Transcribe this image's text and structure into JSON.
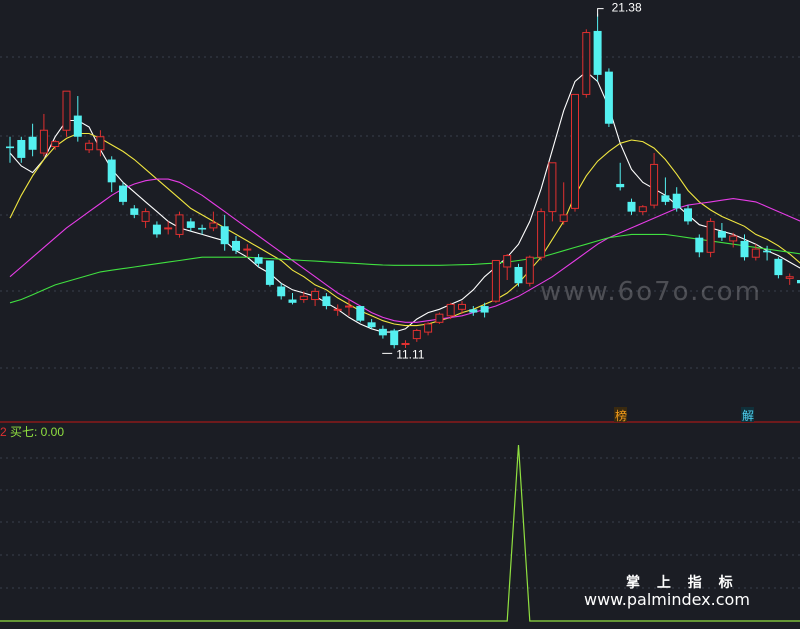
{
  "chart_data": [
    {
      "type": "candlestick",
      "panel": "main",
      "price_range": [
        8.9,
        21.8
      ],
      "high_label": "21.38",
      "low_label": "11.11",
      "candles": [
        {
          "o": 17.3,
          "h": 17.6,
          "l": 16.8,
          "c": 17.25,
          "ma": "up"
        },
        {
          "o": 17.5,
          "h": 17.6,
          "l": 16.8,
          "c": 16.95,
          "ma": "down"
        },
        {
          "o": 17.6,
          "h": 18.0,
          "l": 17.0,
          "c": 17.2,
          "ma": "down"
        },
        {
          "o": 17.1,
          "h": 18.3,
          "l": 17.0,
          "c": 17.8,
          "ma": "up"
        },
        {
          "o": 17.3,
          "h": 17.5,
          "l": 17.2,
          "c": 17.45,
          "ma": "up"
        },
        {
          "o": 17.8,
          "h": 19.0,
          "l": 17.6,
          "c": 19.0,
          "ma": "up"
        },
        {
          "o": 18.25,
          "h": 18.85,
          "l": 17.45,
          "c": 17.6,
          "ma": "down"
        },
        {
          "o": 17.2,
          "h": 17.5,
          "l": 17.1,
          "c": 17.4,
          "ma": "up"
        },
        {
          "o": 17.2,
          "h": 17.8,
          "l": 17.0,
          "c": 17.6,
          "ma": "up"
        },
        {
          "o": 16.9,
          "h": 17.0,
          "l": 15.9,
          "c": 16.2,
          "ma": "down"
        },
        {
          "o": 16.1,
          "h": 16.2,
          "l": 15.5,
          "c": 15.6,
          "ma": "down"
        },
        {
          "o": 15.4,
          "h": 15.5,
          "l": 15.1,
          "c": 15.2,
          "ma": "down"
        },
        {
          "o": 15.0,
          "h": 15.4,
          "l": 14.8,
          "c": 15.3,
          "ma": "up"
        },
        {
          "o": 14.9,
          "h": 15.0,
          "l": 14.5,
          "c": 14.6,
          "ma": "down"
        },
        {
          "o": 14.8,
          "h": 15.0,
          "l": 14.6,
          "c": 14.8,
          "ma": "flat"
        },
        {
          "o": 14.6,
          "h": 15.3,
          "l": 14.5,
          "c": 15.2,
          "ma": "up"
        },
        {
          "o": 15.0,
          "h": 15.1,
          "l": 14.7,
          "c": 14.8,
          "ma": "down"
        },
        {
          "o": 14.8,
          "h": 14.9,
          "l": 14.6,
          "c": 14.75,
          "ma": "down"
        },
        {
          "o": 14.8,
          "h": 15.3,
          "l": 14.7,
          "c": 14.95,
          "ma": "up"
        },
        {
          "o": 14.85,
          "h": 15.2,
          "l": 14.1,
          "c": 14.3,
          "ma": "down"
        },
        {
          "o": 14.4,
          "h": 14.55,
          "l": 14.0,
          "c": 14.1,
          "ma": "down"
        },
        {
          "o": 14.15,
          "h": 14.3,
          "l": 13.9,
          "c": 14.15,
          "ma": "flat"
        },
        {
          "o": 13.9,
          "h": 14.0,
          "l": 13.6,
          "c": 13.7,
          "ma": "down"
        },
        {
          "o": 13.8,
          "h": 13.8,
          "l": 13.0,
          "c": 13.05,
          "ma": "down"
        },
        {
          "o": 13.0,
          "h": 13.1,
          "l": 12.6,
          "c": 12.7,
          "ma": "down"
        },
        {
          "o": 12.6,
          "h": 12.8,
          "l": 12.45,
          "c": 12.5,
          "ma": "down"
        },
        {
          "o": 12.6,
          "h": 12.85,
          "l": 12.5,
          "c": 12.7,
          "ma": "up"
        },
        {
          "o": 12.6,
          "h": 12.95,
          "l": 12.4,
          "c": 12.85,
          "ma": "up"
        },
        {
          "o": 12.7,
          "h": 12.8,
          "l": 12.3,
          "c": 12.4,
          "ma": "down"
        },
        {
          "o": 12.3,
          "h": 12.45,
          "l": 12.1,
          "c": 12.3,
          "ma": "flat"
        },
        {
          "o": 12.4,
          "h": 12.6,
          "l": 12.1,
          "c": 12.4,
          "ma": "flat"
        },
        {
          "o": 12.4,
          "h": 12.4,
          "l": 11.9,
          "c": 11.95,
          "ma": "down"
        },
        {
          "o": 11.9,
          "h": 12.0,
          "l": 11.7,
          "c": 11.75,
          "ma": "down"
        },
        {
          "o": 11.7,
          "h": 11.8,
          "l": 11.4,
          "c": 11.5,
          "ma": "down"
        },
        {
          "o": 11.65,
          "h": 11.7,
          "l": 11.1,
          "c": 11.2,
          "ma": "down"
        },
        {
          "o": 11.25,
          "h": 11.35,
          "l": 11.11,
          "c": 11.25,
          "ma": "flat"
        },
        {
          "o": 11.4,
          "h": 11.7,
          "l": 11.3,
          "c": 11.65,
          "ma": "up"
        },
        {
          "o": 11.6,
          "h": 11.9,
          "l": 11.5,
          "c": 11.85,
          "ma": "up"
        },
        {
          "o": 11.9,
          "h": 12.2,
          "l": 11.85,
          "c": 12.15,
          "ma": "up"
        },
        {
          "o": 12.1,
          "h": 12.5,
          "l": 12.0,
          "c": 12.45,
          "ma": "up"
        },
        {
          "o": 12.3,
          "h": 12.55,
          "l": 12.15,
          "c": 12.45,
          "ma": "up"
        },
        {
          "o": 12.3,
          "h": 12.4,
          "l": 12.1,
          "c": 12.2,
          "ma": "down"
        },
        {
          "o": 12.4,
          "h": 12.5,
          "l": 12.05,
          "c": 12.2,
          "ma": "up"
        },
        {
          "o": 12.55,
          "h": 13.8,
          "l": 12.5,
          "c": 13.8,
          "ma": "up"
        },
        {
          "o": 13.6,
          "h": 14.0,
          "l": 13.2,
          "c": 13.95,
          "ma": "up"
        },
        {
          "o": 13.6,
          "h": 13.7,
          "l": 13.0,
          "c": 13.1,
          "ma": "down"
        },
        {
          "o": 13.1,
          "h": 13.95,
          "l": 13.0,
          "c": 13.9,
          "ma": "up"
        },
        {
          "o": 13.9,
          "h": 15.4,
          "l": 13.8,
          "c": 15.3,
          "ma": "up"
        },
        {
          "o": 15.3,
          "h": 16.8,
          "l": 15.0,
          "c": 16.8,
          "ma": "up"
        },
        {
          "o": 15.0,
          "h": 16.2,
          "l": 14.9,
          "c": 15.2,
          "ma": "down"
        },
        {
          "o": 15.4,
          "h": 18.9,
          "l": 15.3,
          "c": 18.9,
          "ma": "up"
        },
        {
          "o": 18.9,
          "h": 20.9,
          "l": 18.8,
          "c": 20.8,
          "ma": "up"
        },
        {
          "o": 20.85,
          "h": 21.38,
          "l": 19.3,
          "c": 19.5,
          "ma": "down"
        },
        {
          "o": 19.6,
          "h": 19.7,
          "l": 17.9,
          "c": 18.0,
          "ma": "down"
        },
        {
          "o": 16.15,
          "h": 16.8,
          "l": 15.95,
          "c": 16.05,
          "ma": "flat"
        },
        {
          "o": 15.6,
          "h": 15.7,
          "l": 15.2,
          "c": 15.3,
          "ma": "down"
        },
        {
          "o": 15.3,
          "h": 15.5,
          "l": 15.2,
          "c": 15.45,
          "ma": "up"
        },
        {
          "o": 15.5,
          "h": 17.1,
          "l": 15.4,
          "c": 16.75,
          "ma": "up"
        },
        {
          "o": 15.8,
          "h": 16.35,
          "l": 15.5,
          "c": 15.6,
          "ma": "down"
        },
        {
          "o": 15.85,
          "h": 16.05,
          "l": 15.3,
          "c": 15.4,
          "ma": "down"
        },
        {
          "o": 15.4,
          "h": 15.5,
          "l": 14.9,
          "c": 15.0,
          "ma": "down"
        },
        {
          "o": 14.5,
          "h": 14.6,
          "l": 13.9,
          "c": 14.05,
          "ma": "down"
        },
        {
          "o": 14.05,
          "h": 15.1,
          "l": 13.9,
          "c": 15.0,
          "ma": "up"
        },
        {
          "o": 14.7,
          "h": 14.95,
          "l": 14.4,
          "c": 14.5,
          "ma": "down"
        },
        {
          "o": 14.4,
          "h": 14.65,
          "l": 14.2,
          "c": 14.55,
          "ma": "up"
        },
        {
          "o": 14.4,
          "h": 14.6,
          "l": 13.8,
          "c": 13.9,
          "ma": "down"
        },
        {
          "o": 13.9,
          "h": 14.3,
          "l": 13.8,
          "c": 14.15,
          "ma": "up"
        },
        {
          "o": 14.1,
          "h": 14.25,
          "l": 13.8,
          "c": 14.05,
          "ma": "down"
        },
        {
          "o": 13.85,
          "h": 13.9,
          "l": 13.25,
          "c": 13.35,
          "ma": "down"
        },
        {
          "o": 13.25,
          "h": 13.4,
          "l": 13.05,
          "c": 13.3,
          "ma": "up"
        },
        {
          "o": 13.2,
          "h": 13.3,
          "l": 13.05,
          "c": 13.1,
          "ma": "down"
        }
      ],
      "moving_averages": [
        {
          "color": "#ffffff",
          "values": [
            17.1,
            16.7,
            16.5,
            16.9,
            17.6,
            18.1,
            18.1,
            17.9,
            17.2,
            16.6,
            16.2,
            15.9,
            15.6,
            15.3,
            15.0,
            14.8,
            14.7,
            14.6,
            14.5,
            14.4,
            14.1,
            13.9,
            13.6,
            13.4,
            13.1,
            12.9,
            12.8,
            12.7,
            12.5,
            12.3,
            12.05,
            11.85,
            11.7,
            11.6,
            11.6,
            11.7,
            12.0,
            12.2,
            12.3,
            12.45,
            12.6,
            12.9,
            13.3,
            13.6,
            13.9,
            14.3,
            15.0,
            16.0,
            17.2,
            18.4,
            19.3,
            19.6,
            19.3,
            18.5,
            17.4,
            16.6,
            16.2,
            16.0,
            15.8,
            15.5,
            15.2,
            14.9,
            14.8,
            14.7,
            14.6,
            14.45,
            14.3,
            14.1,
            13.95,
            13.75,
            13.55
          ]
        },
        {
          "color": "#f0e640",
          "values": [
            15.1,
            15.8,
            16.4,
            16.9,
            17.3,
            17.55,
            17.7,
            17.7,
            17.55,
            17.35,
            17.15,
            16.9,
            16.6,
            16.3,
            16.0,
            15.7,
            15.4,
            15.2,
            15.0,
            14.8,
            14.6,
            14.4,
            14.2,
            14.0,
            13.8,
            13.5,
            13.3,
            13.05,
            12.9,
            12.65,
            12.45,
            12.25,
            12.1,
            11.95,
            11.85,
            11.8,
            11.8,
            11.85,
            11.95,
            12.05,
            12.2,
            12.3,
            12.45,
            12.6,
            12.8,
            13.1,
            13.5,
            13.9,
            14.45,
            15.0,
            15.8,
            16.4,
            16.85,
            17.15,
            17.4,
            17.5,
            17.45,
            17.25,
            16.9,
            16.45,
            15.95,
            15.6,
            15.35,
            15.15,
            15.0,
            14.85,
            14.6,
            14.45,
            14.25,
            14.0,
            13.7
          ]
        },
        {
          "color": "#e63ce6",
          "values": [
            13.3,
            13.6,
            13.9,
            14.2,
            14.5,
            14.8,
            15.05,
            15.3,
            15.55,
            15.8,
            16.0,
            16.15,
            16.25,
            16.3,
            16.3,
            16.2,
            16.0,
            15.8,
            15.55,
            15.3,
            15.05,
            14.8,
            14.55,
            14.3,
            14.05,
            13.8,
            13.55,
            13.3,
            13.05,
            12.8,
            12.6,
            12.4,
            12.2,
            12.05,
            11.95,
            11.9,
            11.9,
            11.95,
            12.0,
            12.05,
            12.1,
            12.2,
            12.3,
            12.4,
            12.55,
            12.7,
            12.9,
            13.1,
            13.3,
            13.55,
            13.8,
            14.05,
            14.3,
            14.5,
            14.65,
            14.8,
            14.95,
            15.1,
            15.25,
            15.4,
            15.5,
            15.55,
            15.6,
            15.65,
            15.7,
            15.65,
            15.6,
            15.45,
            15.3,
            15.15,
            15.0
          ]
        },
        {
          "color": "#40e040",
          "values": [
            12.5,
            12.6,
            12.75,
            12.9,
            13.05,
            13.15,
            13.25,
            13.35,
            13.45,
            13.5,
            13.55,
            13.6,
            13.65,
            13.7,
            13.75,
            13.8,
            13.85,
            13.9,
            13.9,
            13.9,
            13.9,
            13.9,
            13.88,
            13.86,
            13.84,
            13.82,
            13.8,
            13.78,
            13.76,
            13.74,
            13.72,
            13.7,
            13.68,
            13.66,
            13.65,
            13.65,
            13.65,
            13.65,
            13.65,
            13.66,
            13.67,
            13.68,
            13.7,
            13.72,
            13.75,
            13.8,
            13.85,
            13.9,
            14.0,
            14.1,
            14.2,
            14.3,
            14.4,
            14.5,
            14.55,
            14.6,
            14.6,
            14.6,
            14.6,
            14.55,
            14.5,
            14.45,
            14.4,
            14.35,
            14.3,
            14.25,
            14.2,
            14.15,
            14.1,
            14.05,
            14.0
          ]
        }
      ],
      "markers": [
        "榜",
        "解"
      ]
    },
    {
      "type": "line",
      "panel": "indicator",
      "ylim": [
        0,
        1
      ],
      "series": [
        {
          "name": "买七",
          "color": "#90e040",
          "values": [
            0,
            0,
            0,
            0,
            0,
            0,
            0,
            0,
            0,
            0,
            0,
            0,
            0,
            0,
            0,
            0,
            0,
            0,
            0,
            0,
            0,
            0,
            0,
            0,
            0,
            0,
            0,
            0,
            0,
            0,
            0,
            0,
            0,
            0,
            0,
            0,
            0,
            0,
            0,
            0,
            0,
            0,
            0,
            0,
            0,
            1,
            0,
            0,
            0,
            0,
            0,
            0,
            0,
            0,
            0,
            0,
            0,
            0,
            0,
            0,
            0,
            0,
            0,
            0,
            0,
            0,
            0,
            0,
            0,
            0,
            0
          ]
        }
      ],
      "legend_prefix": "2",
      "legend_label": "买七: 0.00"
    }
  ],
  "watermarks": {
    "site_top": "www.6o7o.com",
    "footer_cn": "掌 上 指 标",
    "footer_url": "www.palmindex.com"
  }
}
